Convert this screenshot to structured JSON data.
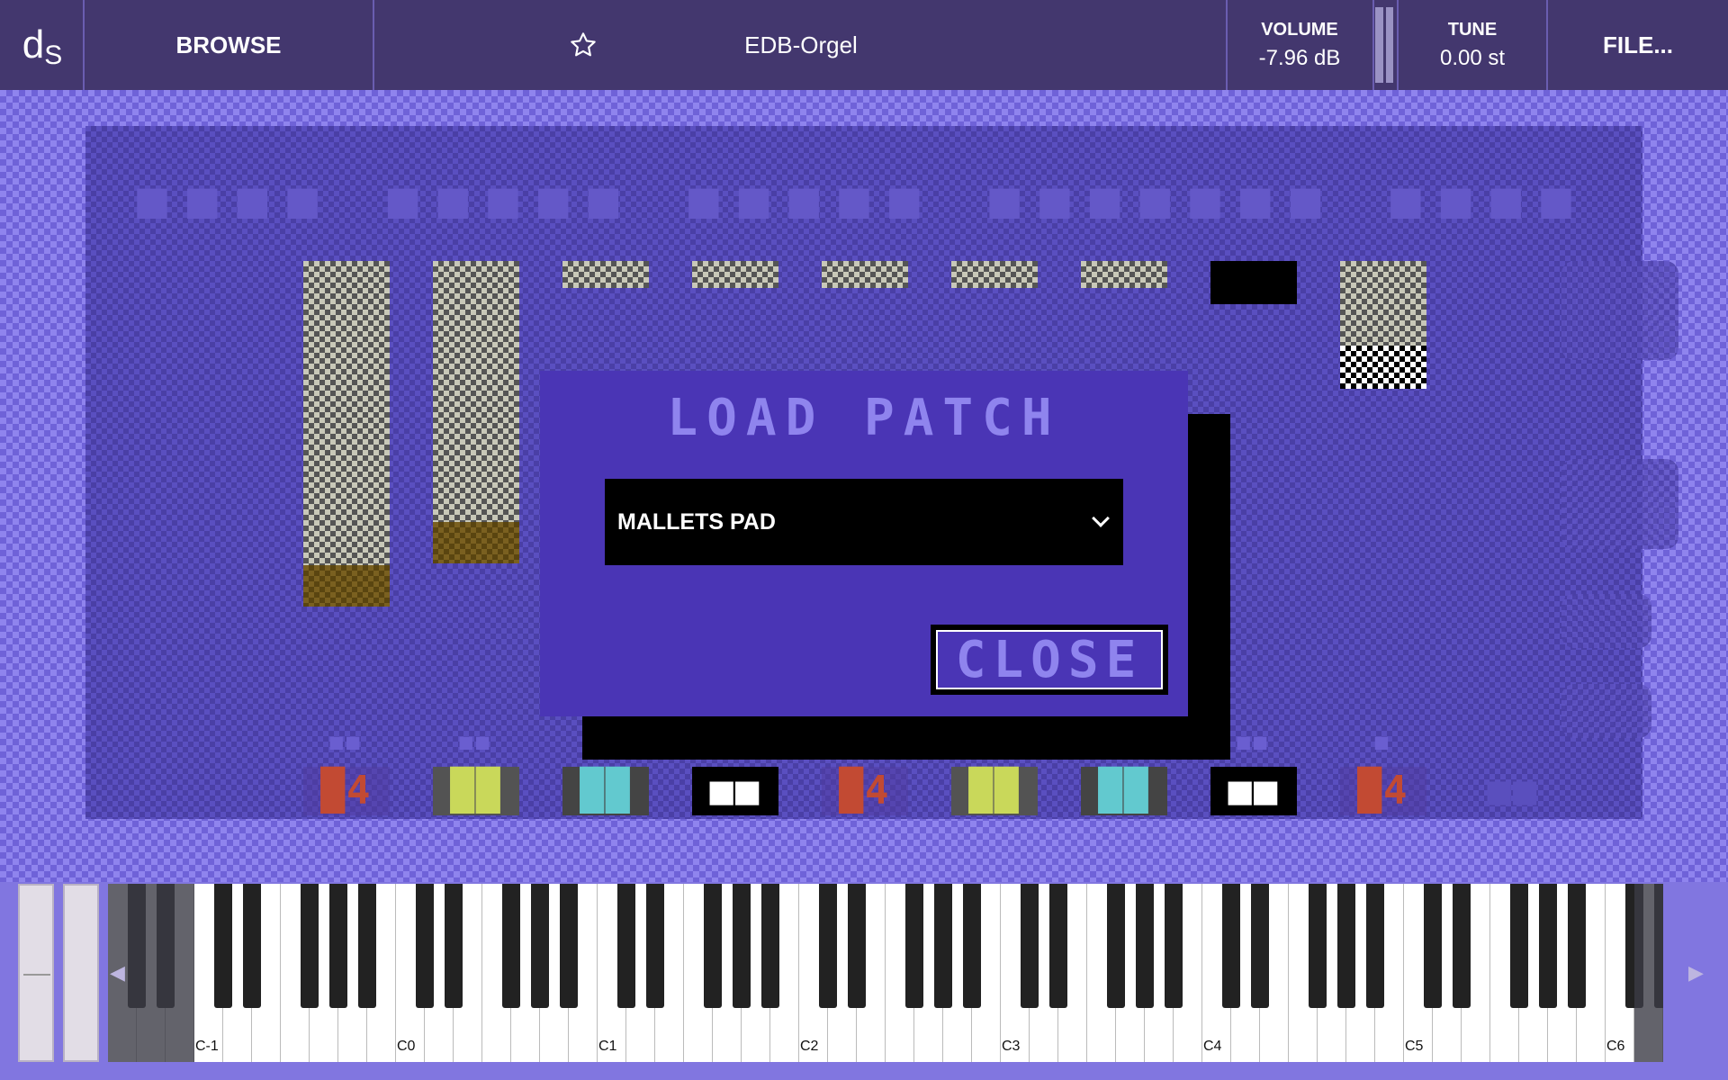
{
  "topbar": {
    "logo_main": "d",
    "logo_sub": "S",
    "browse_label": "BROWSE",
    "patch_name": "EDB-Orgel",
    "volume_label": "VOLUME",
    "volume_value": "-7.96 dB",
    "tune_label": "TUNE",
    "tune_value": "0.00 st",
    "file_label": "FILE..."
  },
  "dialog": {
    "title": "LOAD PATCH",
    "selected_patch": "MALLETS PAD",
    "close_label": "CLOSE"
  },
  "keyboard": {
    "octave_labels": [
      "C-1",
      "C0",
      "C1",
      "C2",
      "C3",
      "C4",
      "C5",
      "C6"
    ]
  },
  "colors": {
    "accent": "#4a35b5",
    "topbar": "#43376e",
    "stage_light": "#8f84ee",
    "stage_dark": "#6f62d8"
  },
  "icons": [
    "star-icon",
    "chevron-down-icon",
    "arrow-left-icon",
    "arrow-right-icon"
  ]
}
